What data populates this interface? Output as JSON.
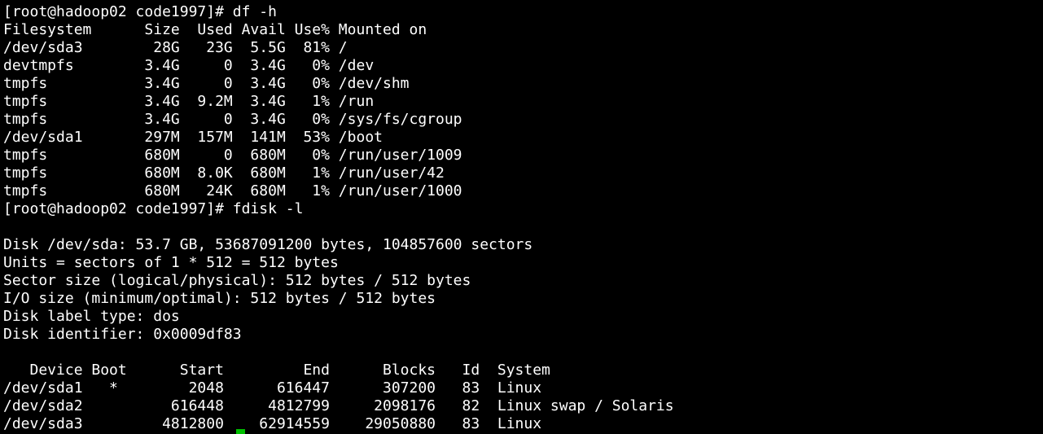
{
  "terminal": {
    "colors": {
      "background": "#000000",
      "foreground": "#ffffff",
      "cursor": "#00c000"
    },
    "lines": [
      "[root@hadoop02 code1997]# df -h",
      "Filesystem      Size  Used Avail Use% Mounted on",
      "/dev/sda3        28G   23G  5.5G  81% /",
      "devtmpfs        3.4G     0  3.4G   0% /dev",
      "tmpfs           3.4G     0  3.4G   0% /dev/shm",
      "tmpfs           3.4G  9.2M  3.4G   1% /run",
      "tmpfs           3.4G     0  3.4G   0% /sys/fs/cgroup",
      "/dev/sda1       297M  157M  141M  53% /boot",
      "tmpfs           680M     0  680M   0% /run/user/1009",
      "tmpfs           680M  8.0K  680M   1% /run/user/42",
      "tmpfs           680M   24K  680M   1% /run/user/1000",
      "[root@hadoop02 code1997]# fdisk -l",
      "",
      "Disk /dev/sda: 53.7 GB, 53687091200 bytes, 104857600 sectors",
      "Units = sectors of 1 * 512 = 512 bytes",
      "Sector size (logical/physical): 512 bytes / 512 bytes",
      "I/O size (minimum/optimal): 512 bytes / 512 bytes",
      "Disk label type: dos",
      "Disk identifier: 0x0009df83",
      "",
      "   Device Boot      Start         End      Blocks   Id  System",
      "/dev/sda1   *        2048      616447      307200   83  Linux",
      "/dev/sda2          616448     4812799     2098176   82  Linux swap / Solaris",
      "/dev/sda3         4812800    62914559    29050880   83  Linux"
    ]
  }
}
